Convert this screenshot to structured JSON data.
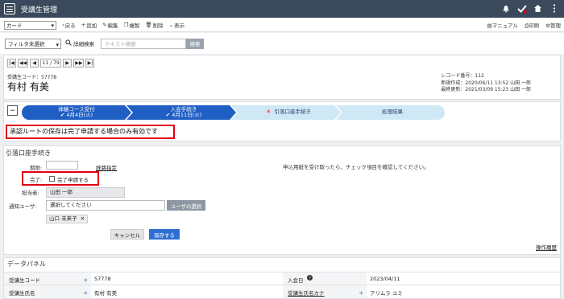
{
  "app": {
    "title": "受講生管理"
  },
  "toolbar": {
    "view_select": "カード",
    "back": "戻る",
    "add": "追加",
    "edit": "編集",
    "copy": "複製",
    "delete": "削除",
    "display": "表示",
    "manual": "マニュアル",
    "print": "印刷",
    "admin": "管理"
  },
  "filter": {
    "filter_select": "フィルタ未選択",
    "advanced_search": "詳細検索",
    "text_search_placeholder": "テキスト検索",
    "search_button": "検索"
  },
  "pager": {
    "first": "|◀",
    "prev_fast": "◀◀",
    "prev": "◀",
    "count": "11 / 79",
    "next": "▶",
    "next_fast": "▶▶",
    "last": "▶|"
  },
  "record": {
    "code_label": "受講生コード：57778",
    "name": "有村 有美",
    "record_no": "レコード番号：112",
    "created": "新規作成：2020/06/11 13:52 山田 一郎",
    "updated": "最終更新：2021/03/09 15:23 山田 一郎"
  },
  "process": {
    "steps": [
      {
        "label": "体験コース受付",
        "sub": "✔ 4月4日(火)",
        "status": "done"
      },
      {
        "label": "入会手続き",
        "sub": "✔ 4月11日(火)",
        "status": "done"
      },
      {
        "label": "引落口座手続き",
        "sub": "",
        "status": "current",
        "marker": "＊"
      },
      {
        "label": "処理結果",
        "sub": "",
        "status": "todo"
      }
    ],
    "alert": "承認ルートの保存は完了申請する場合のみ有効です"
  },
  "form": {
    "title": "引落口座手続き",
    "deadline_label": "期限:",
    "path_link": "経路指定",
    "instruction": "申込用紙を受け取ったら、チェック項目を確認してください。",
    "complete_label": "完了:",
    "complete_checkbox": "完了申請する",
    "assignee_label": "担当者:",
    "assignee_value": "山田 一郎",
    "notify_label": "通知ユーザ:",
    "notify_placeholder": "選択してください",
    "user_select_button": "ユーザの選択",
    "notify_tag": "山口 未来子",
    "tag_remove": "✕",
    "cancel": "キャンセル",
    "save": "保存する",
    "history_link": "操作履歴"
  },
  "data_panel": {
    "title": "データパネル",
    "rows": [
      {
        "l1": "受講生コード",
        "v1": "57778",
        "l2": "入会日",
        "v2": "2023/04/11"
      },
      {
        "l1": "受講生氏名",
        "v1": "有村 有美",
        "l2": "受講生氏名カナ",
        "v2": "アリムラ ユミ"
      }
    ]
  },
  "colors": {
    "header": "#3a4a5c",
    "accent": "#1f5fc4",
    "alert": "#e00012",
    "todo_step": "#cfe8f6"
  }
}
